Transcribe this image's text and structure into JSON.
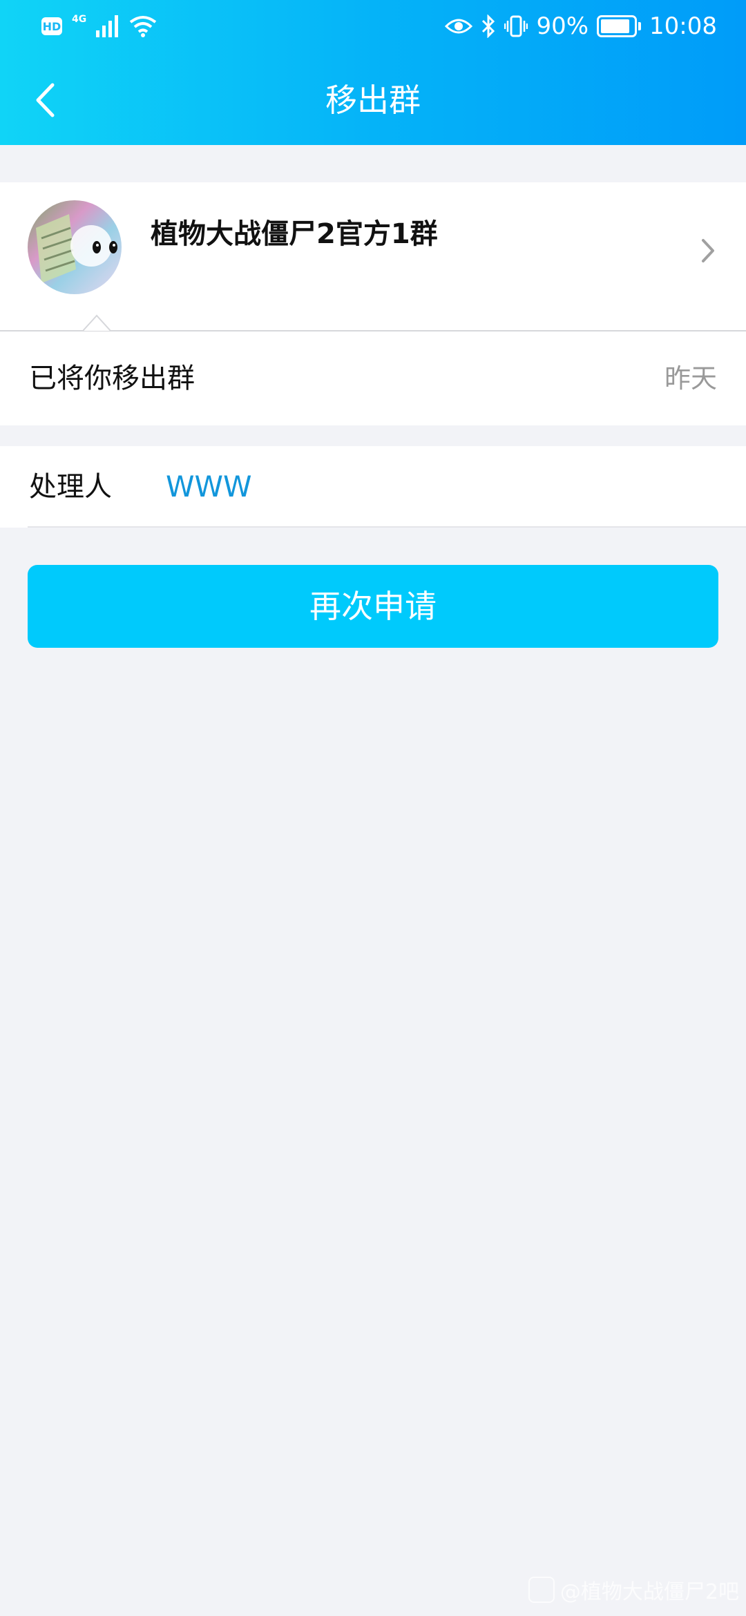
{
  "status_bar": {
    "hd_label": "HD",
    "network_label": "4G",
    "battery_text": "90%",
    "battery_level": 0.9,
    "time": "10:08",
    "icons": [
      "signal-icon",
      "wifi-icon",
      "eye-icon",
      "bluetooth-icon",
      "vibrate-icon",
      "battery-icon"
    ]
  },
  "nav": {
    "title": "移出群",
    "back_icon": "chevron-left-icon"
  },
  "group": {
    "name": "植物大战僵尸2官方1群",
    "chevron_icon": "chevron-right-icon"
  },
  "message": {
    "text": "已将你移出群",
    "time": "昨天"
  },
  "handler": {
    "label": "处理人",
    "name": "WWW"
  },
  "actions": {
    "apply_again_label": "再次申请"
  },
  "watermark": {
    "text": "@植物大战僵尸2吧"
  },
  "colors": {
    "header_start": "#10d4f7",
    "header_end": "#009cf9",
    "button": "#00cafc",
    "link": "#1296db",
    "background": "#f2f3f7"
  }
}
